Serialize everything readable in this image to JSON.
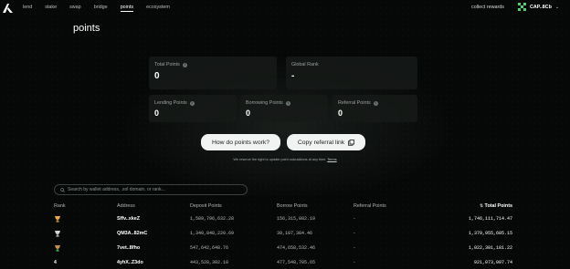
{
  "nav": {
    "links": [
      {
        "label": "lend"
      },
      {
        "label": "stake"
      },
      {
        "label": "swap"
      },
      {
        "label": "bridge"
      },
      {
        "label": "points",
        "active": true
      },
      {
        "label": "ecosystem"
      }
    ],
    "collect_rewards": "collect rewards",
    "wallet_label": "CAP..8Cb"
  },
  "page_title": "points",
  "stats": {
    "total_points": {
      "label": "Total Points",
      "value": "0"
    },
    "global_rank": {
      "label": "Global Rank",
      "value": "-"
    },
    "lending_points": {
      "label": "Lending Points",
      "value": "0"
    },
    "borrowing_points": {
      "label": "Borrowing Points",
      "value": "0"
    },
    "referral_points": {
      "label": "Referral Points",
      "value": "0"
    }
  },
  "buttons": {
    "how_points": "How do points work?",
    "copy_referral": "Copy referral link"
  },
  "disclaimer": {
    "text": "We reserve the right to update point calculations at any time.",
    "link": "Terms"
  },
  "search": {
    "placeholder": "Search by wallet address, .sol domain, or rank..."
  },
  "leaderboard": {
    "columns": {
      "rank": "Rank",
      "address": "Address",
      "deposit": "Deposit Points",
      "borrow": "Borrow Points",
      "referral": "Referral Points",
      "total": "Total Points"
    },
    "rows": [
      {
        "rank": "1",
        "rank_icon": "gold-trophy-icon",
        "address": "Sffv..xkeZ",
        "deposit": "1,589,796,632.28",
        "borrow": "156,315,082.19",
        "referral": "-",
        "total": "1,746,111,714.47"
      },
      {
        "rank": "2",
        "rank_icon": "silver-trophy-icon",
        "address": "QM3A..82mC",
        "deposit": "1,340,848,220.69",
        "borrow": "39,107,384.46",
        "referral": "-",
        "total": "1,379,955,605.15"
      },
      {
        "rank": "3",
        "rank_icon": "bronze-trophy-icon",
        "address": "7vet..8fho",
        "deposit": "547,642,648.76",
        "borrow": "474,658,532.46",
        "referral": "-",
        "total": "1,022,301,181.22"
      },
      {
        "rank": "4",
        "rank_icon": "",
        "address": "4yhX..Z3do",
        "deposit": "443,528,302.10",
        "borrow": "477,548,705.65",
        "referral": "-",
        "total": "921,073,007.74"
      }
    ]
  },
  "colors": {
    "background": "#060807",
    "accent_green": "#4fd16a",
    "gold": "#e8a93a",
    "silver": "#cfd4d8",
    "bronze": "#c98a4b"
  }
}
